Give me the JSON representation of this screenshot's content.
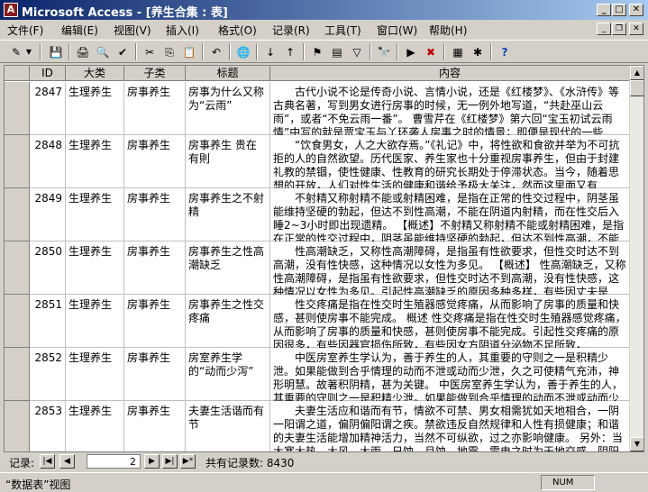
{
  "window": {
    "title": "Microsoft Access - [养生合集 : 表]",
    "app_icon": "access-icon"
  },
  "menu": [
    "文件(F)",
    "编辑(E)",
    "视图(V)",
    "插入(I)",
    "格式(O)",
    "记录(R)",
    "工具(T)",
    "窗口(W)",
    "帮助(H)"
  ],
  "toolbar": {
    "buttons": [
      "view-icon",
      "save-icon",
      "print-icon",
      "print-preview-icon",
      "spelling-icon",
      "cut-icon",
      "copy-icon",
      "paste-icon",
      "undo-icon",
      "hyperlink-icon",
      "sort-asc-icon",
      "sort-desc-icon",
      "filter-selection-icon",
      "filter-form-icon",
      "apply-filter-icon",
      "find-icon",
      "new-record-icon",
      "delete-record-icon",
      "database-window-icon",
      "new-object-icon",
      "help-icon"
    ],
    "glyphs": [
      "✎",
      "▼",
      "💾",
      "🖨",
      "🔍",
      "✔",
      "✂",
      "⎘",
      "📋",
      "↶",
      "🌐",
      "↓",
      "↑",
      "⚑",
      "▤",
      "▽",
      "🔭",
      "▶",
      "✖",
      "▦",
      "✱",
      "?"
    ]
  },
  "table": {
    "columns": [
      "ID",
      "大类",
      "子类",
      "标题",
      "内容"
    ],
    "rows": [
      {
        "id": "2847",
        "category": "生理养生",
        "subcategory": "房事养生",
        "title": "房事为什么又称为“云雨”",
        "content": "古代小说不论是传奇小说、言情小说，还是《红楼梦》、《水浒传》等古典名著，写到男女进行房事的时候，无一例外地写道，“共赴巫山云雨”，或者“不免云雨一番”。 曹雪芹在《红楼梦》第六回“宝玉初试云雨情”中写的就是贾宝玉与丫环袭人房事之时的情景；即便是现代的一些"
      },
      {
        "id": "2848",
        "category": "生理养生",
        "subcategory": "房事养生",
        "title": "房事养生 贵在有則",
        "content": "“饮食男女，人之大欲存焉。”《礼记》中，将性欲和食欲并举为不可抗拒的人的自然欲望。历代医家、养生家也十分重视房事养生，但由于封建礼教的禁锢，使性健康、性教育的研究长期处于停滞状态。当今，随着思想的开放，人们对性生活的健康和谐给予极大关注，然而这里面又有"
      },
      {
        "id": "2849",
        "category": "生理养生",
        "subcategory": "房事养生",
        "title": "房事养生之不射精",
        "content": "不射精又称射精不能或射精困难，是指在正常的性交过程中，阴茎虽能维持坚硬的勃起，但达不到性高潮，不能在阴道内射精，而在性交后入睡2~3小时即出现遗精。 【概述】不射精又称射精不能或射精困难，是指在正常的性交过程中，阴茎虽能维持坚硬的勃起，但达不到性高潮，不能"
      },
      {
        "id": "2850",
        "category": "生理养生",
        "subcategory": "房事养生",
        "title": "房事养生之性高潮缺乏",
        "content": "性高潮缺乏，又称性高潮障碍，是指虽有性欲要求，但性交时达不到高潮，没有性快感，这种情况以女性为多见。 【概述】 性高潮缺乏，又称性高潮障碍，是指虽有性欲要求，但性交时达不到高潮，没有性快感，这种情况以女性为多见。引起性高潮缺乏的原因多种多样，有些因丈夫是"
      },
      {
        "id": "2851",
        "category": "生理养生",
        "subcategory": "房事养生",
        "title": "房事养生之性交疼痛",
        "content": "性交疼痛是指在性交时生殖器感觉疼痛，从而影响了房事的质量和快感，甚则使房事不能完成。 概述 性交疼痛是指在性交时生殖器感觉疼痛，从而影响了房事的质量和快感，甚则使房事不能完成。引起性交疼痛的原因很多，有些因器官损伤所致，有些因女方阴道分泌物不足所致，"
      },
      {
        "id": "2852",
        "category": "生理养生",
        "subcategory": "房事养生",
        "title": "房室养生学的“动而少泻”",
        "content": "中医房室养生学认为，善于养生的人，其重要的守则之一是积精少泄。如果能做到合乎情理的动而不泄或动而少泄，久之可使精气充沛，神形明慧。故著积阴精，甚为关键。 中医房室养生学认为，善于养生的人，其重要的守则之一是积精少泄。如果能做到合乎情理的动而不泄或动而少"
      },
      {
        "id": "2853",
        "category": "生理养生",
        "subcategory": "房事养生",
        "title": "夫妻生活谐而有节",
        "content": "夫妻生活应和谐而有节，情欲不可禁、男女相需犹如天地相合，一阴一阳谓之道，偏阴偏阳谓之疾。禁欲违反自然规律和人性有损健康；和谐的夫妻生活能增加精神活力，当然不可纵欲，过之亦影响健康。 另外：当大寒大热、大风、大雨、日蚀、月蚀、地震、雷电之时为天地交感，阴阳"
      }
    ]
  },
  "navigation": {
    "label": "记录:",
    "current": "2",
    "count_text": "共有记录数: 8430",
    "buttons": [
      "first-record",
      "prev-record",
      "next-record",
      "last-record",
      "new-record"
    ],
    "glyphs": [
      "|◀",
      "◀",
      "▶",
      "▶|",
      "▶*"
    ]
  },
  "status": {
    "text": "“数据表”视图",
    "num": "NUM"
  }
}
